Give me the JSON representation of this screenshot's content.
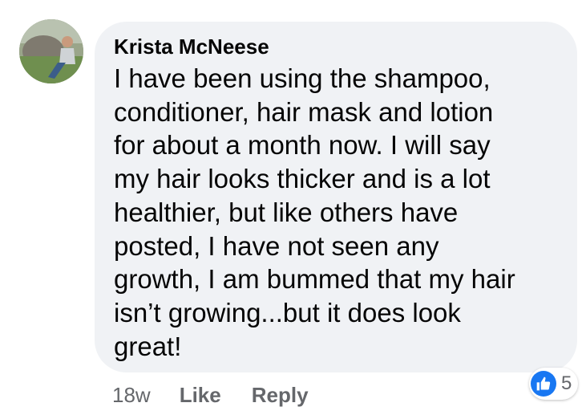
{
  "comment": {
    "author": "Krista McNeese",
    "text": "I have been using the shampoo,\nconditioner, hair mask and lotion\nfor about a month now. I will say\nmy hair looks thicker and is a lot\nhealthier, but like others have\nposted, I have not seen any\ngrowth, I am bummed that my hair\nisn’t growing...but it does look\ngreat!",
    "time": "18w",
    "like_label": "Like",
    "reply_label": "Reply",
    "reaction_count": "5",
    "reaction_icon": "thumbs-up-icon"
  },
  "colors": {
    "bubble": "#f0f2f5",
    "text": "#050505",
    "meta": "#65676b",
    "like_blue": "#1877f2"
  }
}
